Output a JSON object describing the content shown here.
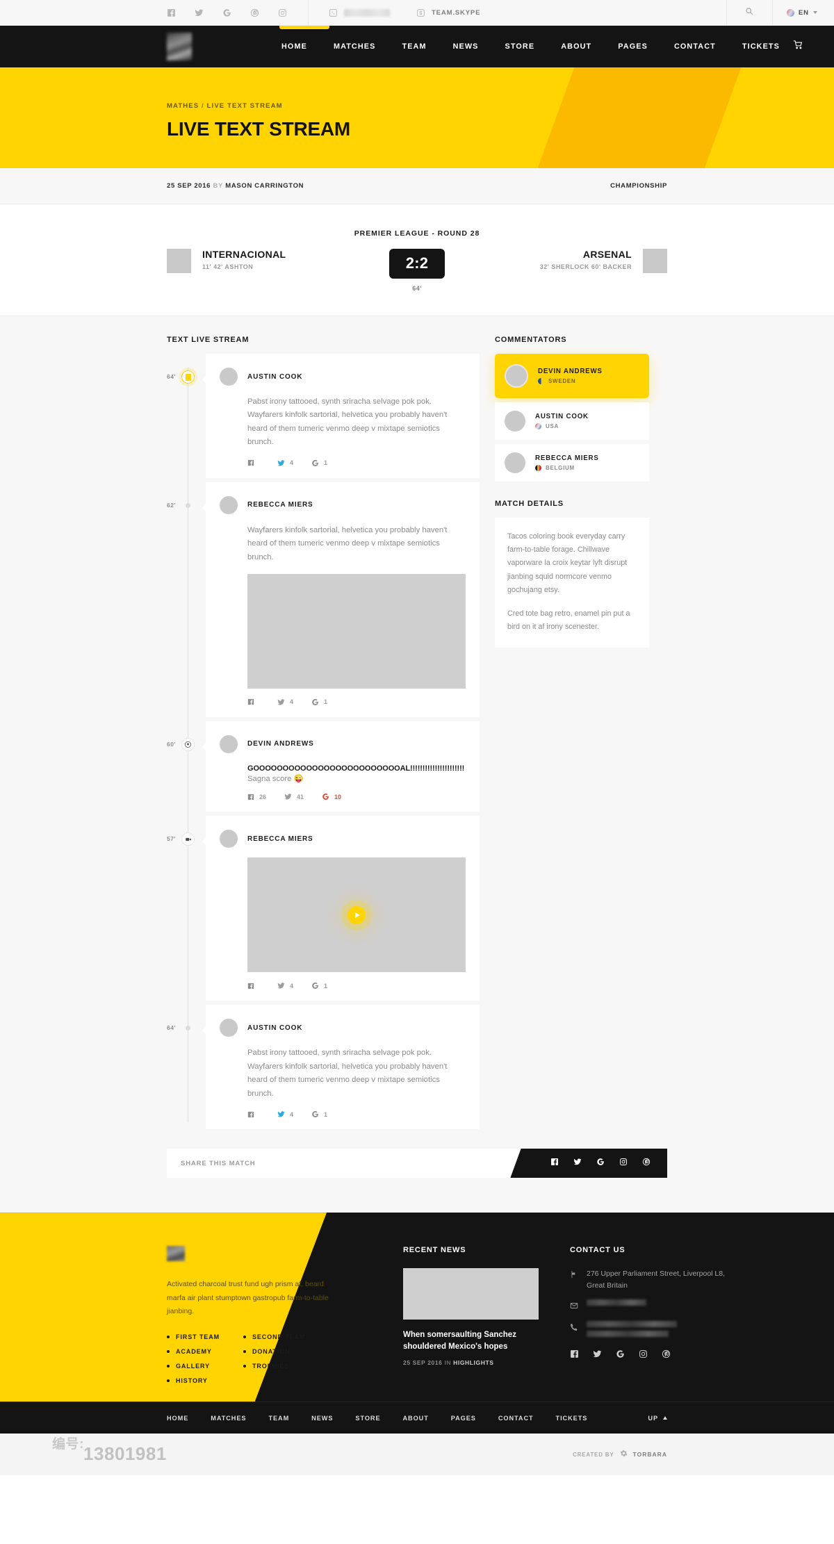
{
  "topbar": {
    "social": [
      "facebook-icon",
      "twitter-icon",
      "google-icon",
      "pinterest-icon",
      "instagram-icon"
    ],
    "phone_label": "",
    "skype_label": "TEAM.SKYPE",
    "search_icon": "search-icon",
    "language": "EN"
  },
  "nav": {
    "items": [
      "HOME",
      "MATCHES",
      "TEAM",
      "NEWS",
      "STORE",
      "ABOUT",
      "PAGES",
      "CONTACT",
      "TICKETS"
    ],
    "cart_icon": "cart-icon",
    "accent_color": "#ffd400"
  },
  "hero": {
    "breadcrumb_root": "MATHES",
    "breadcrumb_sep": "/",
    "breadcrumb_current": "LIVE TEXT STREAM",
    "title": "LIVE TEXT STREAM",
    "bg_color": "#ffd400"
  },
  "meta": {
    "date": "25 SEP 2016",
    "by": "BY",
    "author": "MASON CARRINGTON",
    "competition": "CHAMPIONSHIP"
  },
  "scoreboard": {
    "league": "PREMIER LEAGUE - ROUND 28",
    "home_team": "INTERNACIONAL",
    "home_scorers": "11' 42' ASHTON",
    "away_team": "ARSENAL",
    "away_scorers": "32' SHERLOCK   60' BACKER",
    "score": "2:2",
    "minute": "64'"
  },
  "stream": {
    "title": "TEXT LIVE STREAM",
    "posts": [
      {
        "minute": "64'",
        "marker": "yellow-card-icon",
        "author": "AUSTIN COOK",
        "text": "Pabst irony tattooed, synth sriracha selvage pok pok. Wayfarers kinfolk sartorial, helvetica you probably haven't heard of them tumeric venmo deep v mixtape semiotics brunch.",
        "media": "none",
        "facebook": "",
        "twitter": "4",
        "google": "1"
      },
      {
        "minute": "62'",
        "marker": "dot-icon",
        "author": "REBECCA MIERS",
        "text": "Wayfarers kinfolk sartorial, helvetica you probably haven't heard of them tumeric venmo deep v mixtape semiotics brunch.",
        "media": "image",
        "facebook": "",
        "twitter": "4",
        "google": "1"
      },
      {
        "minute": "60'",
        "marker": "soccer-ball-icon",
        "author": "DEVIN ANDREWS",
        "goal_text": "GOOOOOOOOOOOOOOOOOOOOOOOOOAL!!!!!!!!!!!!!!!!!!!!!!",
        "text": "Sagna score 😜",
        "media": "none",
        "facebook": "26",
        "twitter": "41",
        "google": "10"
      },
      {
        "minute": "57'",
        "marker": "video-camera-icon",
        "author": "REBECCA MIERS",
        "text": "",
        "media": "video",
        "facebook": "",
        "twitter": "4",
        "google": "1"
      },
      {
        "minute": "64'",
        "marker": "dot-icon",
        "author": "AUSTIN COOK",
        "text": "Pabst irony tattooed, synth sriracha selvage pok pok. Wayfarers kinfolk sartorial, helvetica you probably haven't heard of them tumeric venmo deep v mixtape semiotics brunch.",
        "media": "none",
        "facebook": "",
        "twitter": "4",
        "google": "1"
      }
    ],
    "share_label": "SHARE THIS MATCH",
    "share_icons": [
      "facebook-icon",
      "twitter-icon",
      "google-icon",
      "instagram-icon",
      "pinterest-icon"
    ]
  },
  "commentators": {
    "title": "COMMENTATORS",
    "items": [
      {
        "name": "DEVIN ANDREWS",
        "country": "SWEDEN",
        "flag": "#f7d117",
        "active": true
      },
      {
        "name": "AUSTIN COOK",
        "country": "USA",
        "flag": "#d96b7e",
        "active": false
      },
      {
        "name": "REBECCA MIERS",
        "country": "BELGIUM",
        "flag": "#e3a41d",
        "active": false
      }
    ]
  },
  "match_details": {
    "title": "MATCH DETAILS",
    "paragraph_1": "Tacos coloring book everyday carry farm-to-table forage. Chillwave vaporware la croix keytar lyft disrupt jianbing squid normcore venmo gochujang etsy.",
    "paragraph_2": "Cred tote bag retro, enamel pin put a bird on it af irony scenester."
  },
  "footer": {
    "about_text": "Activated charcoal trust fund ugh prism af, beard marfa air plant stumptown gastropub farm-to-table jianbing.",
    "links_col1": [
      "FIRST TEAM",
      "ACADEMY",
      "GALLERY",
      "HISTORY"
    ],
    "links_col2": [
      "SECOND TEAM",
      "DONATION",
      "TROPHIES"
    ],
    "recent_news_title": "RECENT NEWS",
    "news_headline": "When somersaulting Sanchez shouldered Mexico's hopes",
    "news_date": "25 SEP 2016",
    "news_in": "IN",
    "news_category": "HIGHLIGHTS",
    "contact_title": "CONTACT US",
    "address": "276 Upper Parliament Street, Liverpool L8, Great Britain",
    "email": "",
    "phone": "",
    "social": [
      "facebook-icon",
      "twitter-icon",
      "google-icon",
      "instagram-icon",
      "pinterest-icon"
    ],
    "nav_items": [
      "HOME",
      "MATCHES",
      "TEAM",
      "NEWS",
      "STORE",
      "ABOUT",
      "PAGES",
      "CONTACT",
      "TICKETS"
    ],
    "up_label": "UP",
    "copyright": "",
    "created_by": "CREATED BY",
    "brand": "TORBARA",
    "watermark": "13801981",
    "watermark2": "编号:"
  }
}
